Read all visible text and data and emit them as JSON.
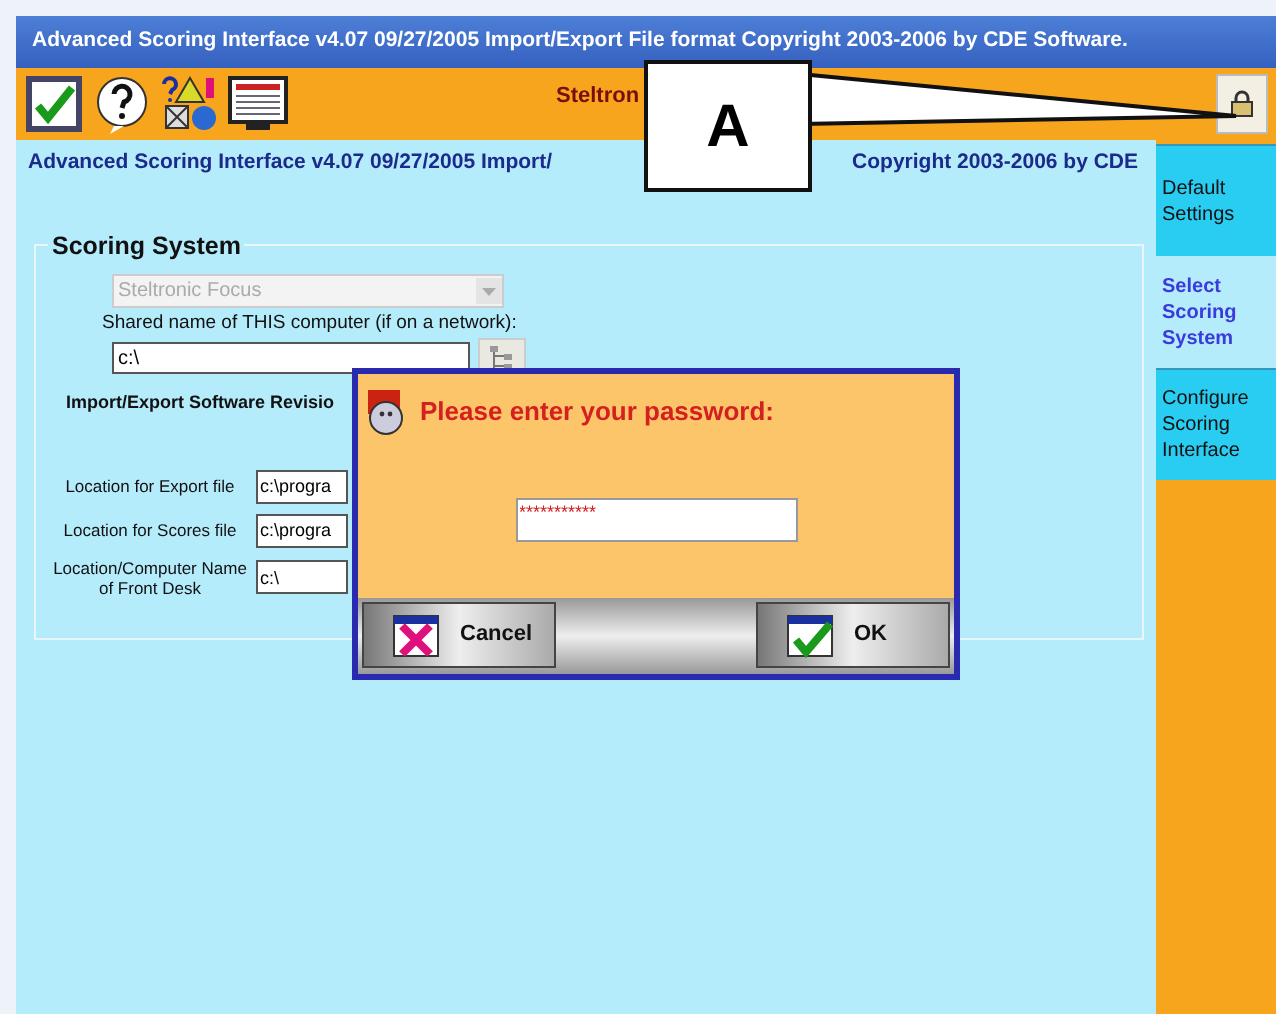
{
  "window": {
    "title": "Advanced Scoring Interface  v4.07  09/27/2005  Import/Export File format Copyright 2003-2006 by CDE Software."
  },
  "toolbar": {
    "header": "Steltron"
  },
  "subtitle": {
    "left": "Advanced Scoring Interface  v4.07  09/27/2005  Import/",
    "right": "Copyright 2003-2006 by CDE"
  },
  "scoring_system": {
    "legend": "Scoring System",
    "dropdown": {
      "value": "Steltronic Focus",
      "disabled": true
    },
    "shared_label": "Shared name of THIS computer (if on a network):",
    "shared_value": "c:\\"
  },
  "import_export": {
    "heading": "Import/Export Software Revisio",
    "fields": [
      {
        "label": "Location for Export file",
        "value": "c:\\progra"
      },
      {
        "label": "Location for Scores file",
        "value": "c:\\progra"
      },
      {
        "label": "Location/Computer Name of Front Desk",
        "value": "c:\\"
      }
    ]
  },
  "side_tabs": [
    {
      "label": "Default Settings",
      "selected": false
    },
    {
      "label": "Select Scoring System",
      "selected": true
    },
    {
      "label": "Configure Scoring Interface",
      "selected": false
    }
  ],
  "dialog": {
    "prompt": "Please enter your password:",
    "password": "***********",
    "buttons": [
      {
        "kind": "cancel",
        "label": "Cancel"
      },
      {
        "kind": "ok",
        "label": "OK"
      }
    ]
  },
  "callout": {
    "label": "A"
  }
}
